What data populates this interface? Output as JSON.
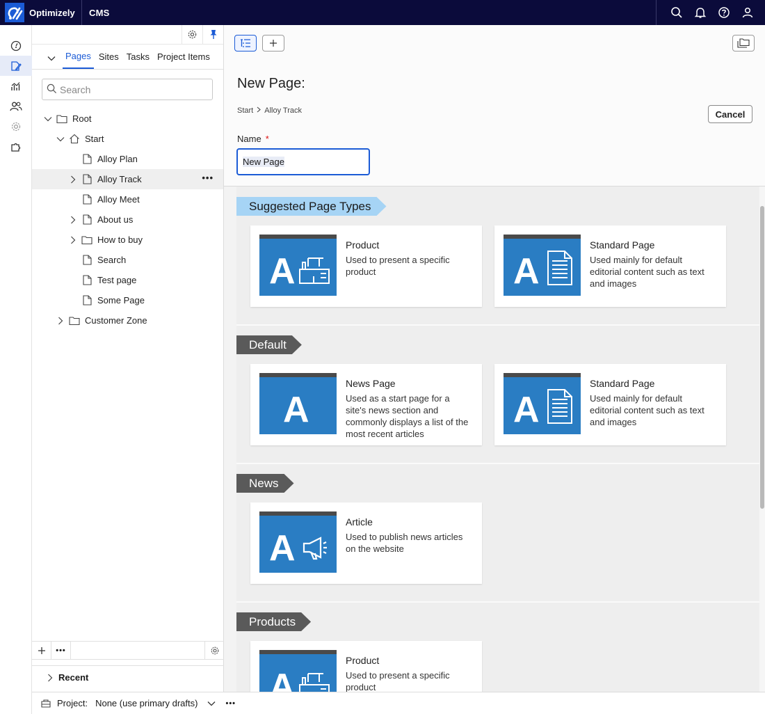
{
  "topbar": {
    "brand": "Optimizely",
    "product": "CMS",
    "icons": [
      "search-icon",
      "bell-icon",
      "help-icon",
      "user-icon"
    ]
  },
  "rail": {
    "icons": [
      "dashboard-icon",
      "edit-icon",
      "analytics-icon",
      "users-icon",
      "settings-icon",
      "addons-icon"
    ],
    "active": "edit-icon"
  },
  "nav": {
    "tabs": [
      "Pages",
      "Sites",
      "Tasks",
      "Project Items"
    ],
    "active_tab": "Pages",
    "search_placeholder": "Search",
    "tree": [
      {
        "label": "Root",
        "icon": "folder-icon",
        "expanded": true
      },
      {
        "label": "Start",
        "icon": "home-icon",
        "expanded": true
      },
      {
        "label": "Alloy Plan",
        "icon": "page-icon"
      },
      {
        "label": "Alloy Track",
        "icon": "page-icon",
        "selected": true
      },
      {
        "label": "Alloy Meet",
        "icon": "page-icon"
      },
      {
        "label": "About us",
        "icon": "page-icon"
      },
      {
        "label": "How to buy",
        "icon": "folder-icon"
      },
      {
        "label": "Search",
        "icon": "page-icon"
      },
      {
        "label": "Test page",
        "icon": "page-icon"
      },
      {
        "label": "Some Page",
        "icon": "page-icon"
      },
      {
        "label": "Customer Zone",
        "icon": "folder-icon"
      }
    ],
    "recent_label": "Recent"
  },
  "status": {
    "project_label": "Project:",
    "project_value": "None (use primary drafts)"
  },
  "main": {
    "title": "New Page:",
    "breadcrumb": [
      "Start",
      "Alloy Track"
    ],
    "cancel_label": "Cancel",
    "name_label": "Name",
    "required_mark": "*",
    "name_value": "New Page"
  },
  "groups": [
    {
      "label": "Suggested Page Types",
      "cards": [
        {
          "title": "Product",
          "description": "Used to present a specific product",
          "thumb": "product-thumbnail-icon"
        },
        {
          "title": "Standard Page",
          "description": "Used mainly for default editorial content such as text and images",
          "thumb": "standard-page-thumbnail-icon"
        }
      ]
    },
    {
      "label": "Default",
      "cards": [
        {
          "title": "News Page",
          "description": "Used as a start page for a site's news section and commonly displays a list of the most recent articles",
          "thumb": "news-page-thumbnail-icon"
        },
        {
          "title": "Standard Page",
          "description": "Used mainly for default editorial content such as text and images",
          "thumb": "standard-page-thumbnail-icon"
        }
      ]
    },
    {
      "label": "News",
      "cards": [
        {
          "title": "Article",
          "description": "Used to publish news articles on the website",
          "thumb": "article-thumbnail-icon"
        }
      ]
    },
    {
      "label": "Products",
      "cards": [
        {
          "title": "Product",
          "description": "Used to present a specific product",
          "thumb": "product-thumbnail-icon"
        }
      ]
    }
  ],
  "colors": {
    "topbar_bg": "#0b0b3b",
    "accent": "#1b5bd6",
    "thumb_bg": "#2a7dc3",
    "suggested_ribbon": "#a6d4f5",
    "group_ribbon": "#5a5a5a"
  }
}
